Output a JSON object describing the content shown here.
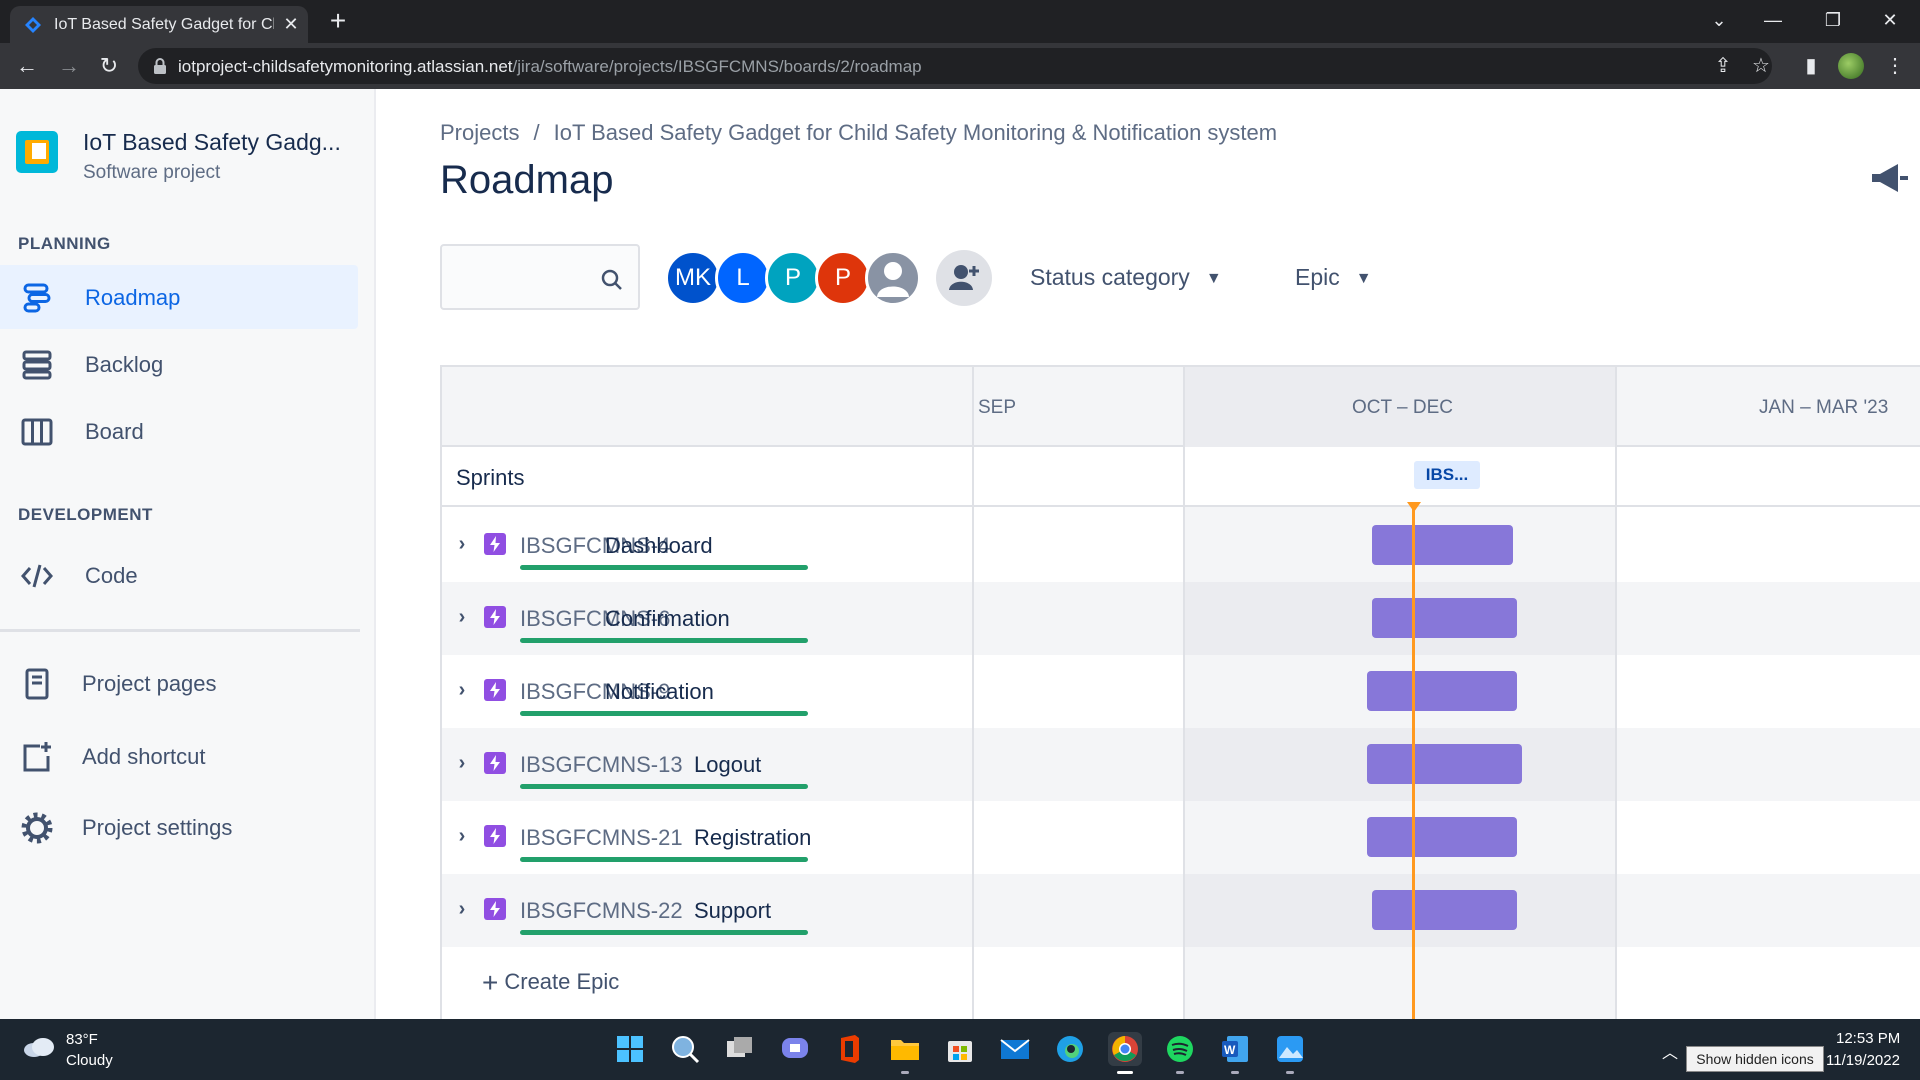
{
  "browser": {
    "tab_title": "IoT Based Safety Gadget for Chil",
    "url_host": "iotproject-childsafetymonitoring.atlassian.net",
    "url_path": "/jira/software/projects/IBSGFCMNS/boards/2/roadmap"
  },
  "sidebar": {
    "project_name": "IoT Based Safety Gadg...",
    "project_type": "Software project",
    "planning_heading": "PLANNING",
    "planning_items": [
      {
        "label": "Roadmap",
        "icon": "roadmap-icon",
        "active": true
      },
      {
        "label": "Backlog",
        "icon": "backlog-icon"
      },
      {
        "label": "Board",
        "icon": "board-icon"
      }
    ],
    "development_heading": "DEVELOPMENT",
    "development_items": [
      {
        "label": "Code",
        "icon": "code-icon"
      }
    ],
    "footer_items": [
      {
        "label": "Project pages",
        "icon": "page-icon"
      },
      {
        "label": "Add shortcut",
        "icon": "add-shortcut-icon"
      },
      {
        "label": "Project settings",
        "icon": "gear-icon"
      }
    ]
  },
  "main": {
    "breadcrumb_root": "Projects",
    "breadcrumb_separator": "/",
    "breadcrumb_project": "IoT Based Safety Gadget for Child Safety Monitoring & Notification system",
    "title": "Roadmap",
    "search_placeholder": "",
    "avatars": [
      {
        "initials": "MK",
        "color": "#0052cc"
      },
      {
        "initials": "L",
        "color": "#0065ff"
      },
      {
        "initials": "P",
        "color": "#00a3bf"
      },
      {
        "initials": "P",
        "color": "#de350b"
      },
      {
        "initials": "",
        "color": "#8993a4"
      }
    ],
    "filter_status": "Status category",
    "filter_epic": "Epic"
  },
  "roadmap": {
    "months": [
      "SEP",
      "OCT – DEC",
      "JAN – MAR '23"
    ],
    "sprints_label": "Sprints",
    "sprint_chip": "IBS...",
    "epics": [
      {
        "key": "IBSGFCMNS-4",
        "name": "Dashboard",
        "progress": 1.0
      },
      {
        "key": "IBSGFCMNS-6",
        "name": "Confirmation",
        "progress": 1.0
      },
      {
        "key": "IBSGFCMNS-9",
        "name": "Notification",
        "progress": 1.0
      },
      {
        "key": "IBSGFCMNS-13",
        "name": "Logout",
        "progress": 1.0
      },
      {
        "key": "IBSGFCMNS-21",
        "name": "Registration",
        "progress": 1.0
      },
      {
        "key": "IBSGFCMNS-22",
        "name": "Support",
        "progress": 1.0
      }
    ],
    "create_epic": "Create Epic",
    "colors": {
      "bar": "#8777d9",
      "today": "#ff991f",
      "progress": "#22a06b",
      "epic_icon": "#904ee2"
    }
  },
  "taskbar": {
    "temperature": "83°F",
    "condition": "Cloudy",
    "tooltip": "Show hidden icons",
    "time": "12:53 PM",
    "date": "11/19/2022"
  }
}
